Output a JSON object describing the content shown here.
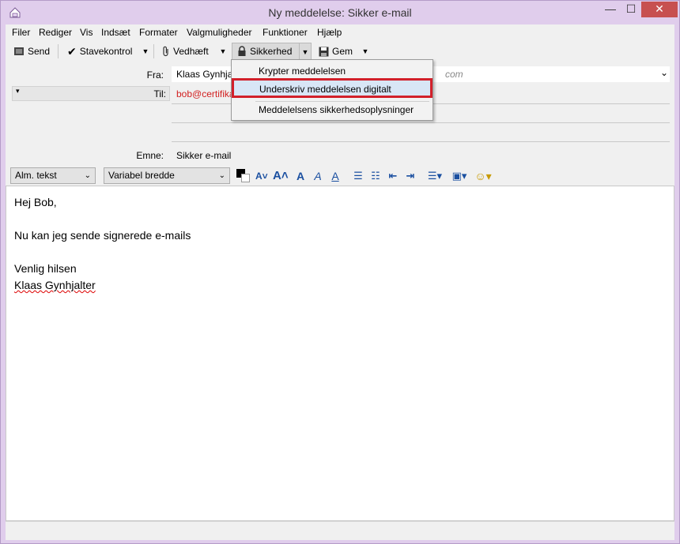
{
  "window": {
    "title": "Ny meddelelse: Sikker e-mail",
    "controls": {
      "minimize": "—",
      "maximize": "☐",
      "close": "✕"
    }
  },
  "menubar": {
    "items": [
      {
        "label": "Filer"
      },
      {
        "label": "Rediger"
      },
      {
        "label": "Vis"
      },
      {
        "label": "Indsæt"
      },
      {
        "label": "Formater"
      },
      {
        "label": "Valgmuligheder"
      },
      {
        "label": "Funktioner"
      },
      {
        "label": "Hjælp"
      }
    ]
  },
  "toolbar": {
    "send": "Send",
    "spellcheck": "Stavekontrol",
    "attach": "Vedhæft",
    "security": "Sikkerhed",
    "save": "Gem"
  },
  "headers": {
    "from_label": "Fra:",
    "from_value": "Klaas Gynhjal",
    "from_value_tail": "com",
    "to_label": "Til:",
    "to_value": "bob@certifika",
    "subject_label": "Emne:",
    "subject_value": "Sikker e-mail"
  },
  "formatbar": {
    "paragraph_style": "Alm. tekst",
    "font": "Variabel bredde"
  },
  "body": {
    "lines": [
      "Hej Bob,",
      "",
      "Nu kan jeg sende signerede e-mails",
      "",
      "Venlig hilsen",
      "Klaas Gynhjalter"
    ]
  },
  "security_menu": {
    "items": [
      {
        "label": "Krypter meddelelsen"
      },
      {
        "label": "Underskriv meddelelsen digitalt"
      },
      {
        "label": "Meddelelsens sikkerhedsoplysninger"
      }
    ]
  },
  "colors": {
    "accent_highlight": "#d2202a",
    "to_address": "#d22020",
    "close_button": "#c75050"
  },
  "icons": [
    "app-icon",
    "send-icon",
    "checkmark-icon",
    "paperclip-icon",
    "lock-icon",
    "floppy-disk-icon",
    "chevron-down-icon",
    "smiley-icon"
  ]
}
